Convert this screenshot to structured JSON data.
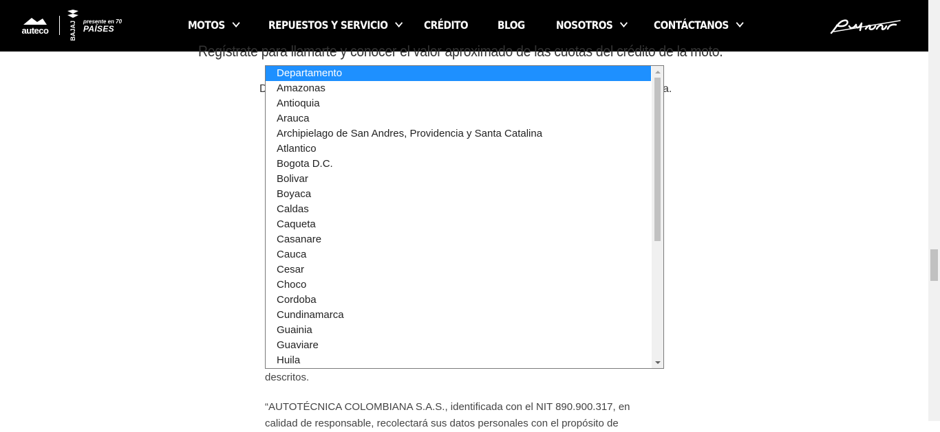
{
  "header": {
    "auteco_logo": "auteco",
    "bajaj_logo": "BAJAJ",
    "countries_line1": "presente en 70",
    "countries_line2": "PAÍSES",
    "nav": [
      {
        "label": "MOTOS",
        "has_dropdown": true
      },
      {
        "label": "REPUESTOS Y SERVICIO",
        "has_dropdown": true
      },
      {
        "label": "CRÉDITO",
        "has_dropdown": false
      },
      {
        "label": "BLOG",
        "has_dropdown": false
      },
      {
        "label": "NOSOTROS",
        "has_dropdown": true
      },
      {
        "label": "CONTÁCTANOS",
        "has_dropdown": true
      }
    ],
    "pulsar_logo": "pulsar",
    "background": "#000000"
  },
  "content": {
    "heading": "Regístrate para llamarte y conocer el valor aproximado de las cuotas del crédito de la moto.",
    "subline_left": "D",
    "subline_right": "a.",
    "para1": "descritos.",
    "para2": "“AUTOTÉCNICA COLOMBIANA S.A.S., identificada con el NIT 890.900.317, en calidad de responsable, recolectará sus datos personales con el propósito de"
  },
  "dropdown": {
    "selected_color": "#1e90ff",
    "options": [
      "Departamento",
      "Amazonas",
      "Antioquia",
      "Arauca",
      "Archipielago de San Andres, Providencia y Santa Catalina",
      "Atlantico",
      "Bogota D.C.",
      "Bolivar",
      "Boyaca",
      "Caldas",
      "Caqueta",
      "Casanare",
      "Cauca",
      "Cesar",
      "Choco",
      "Cordoba",
      "Cundinamarca",
      "Guainia",
      "Guaviare",
      "Huila"
    ],
    "selected_index": 0
  }
}
